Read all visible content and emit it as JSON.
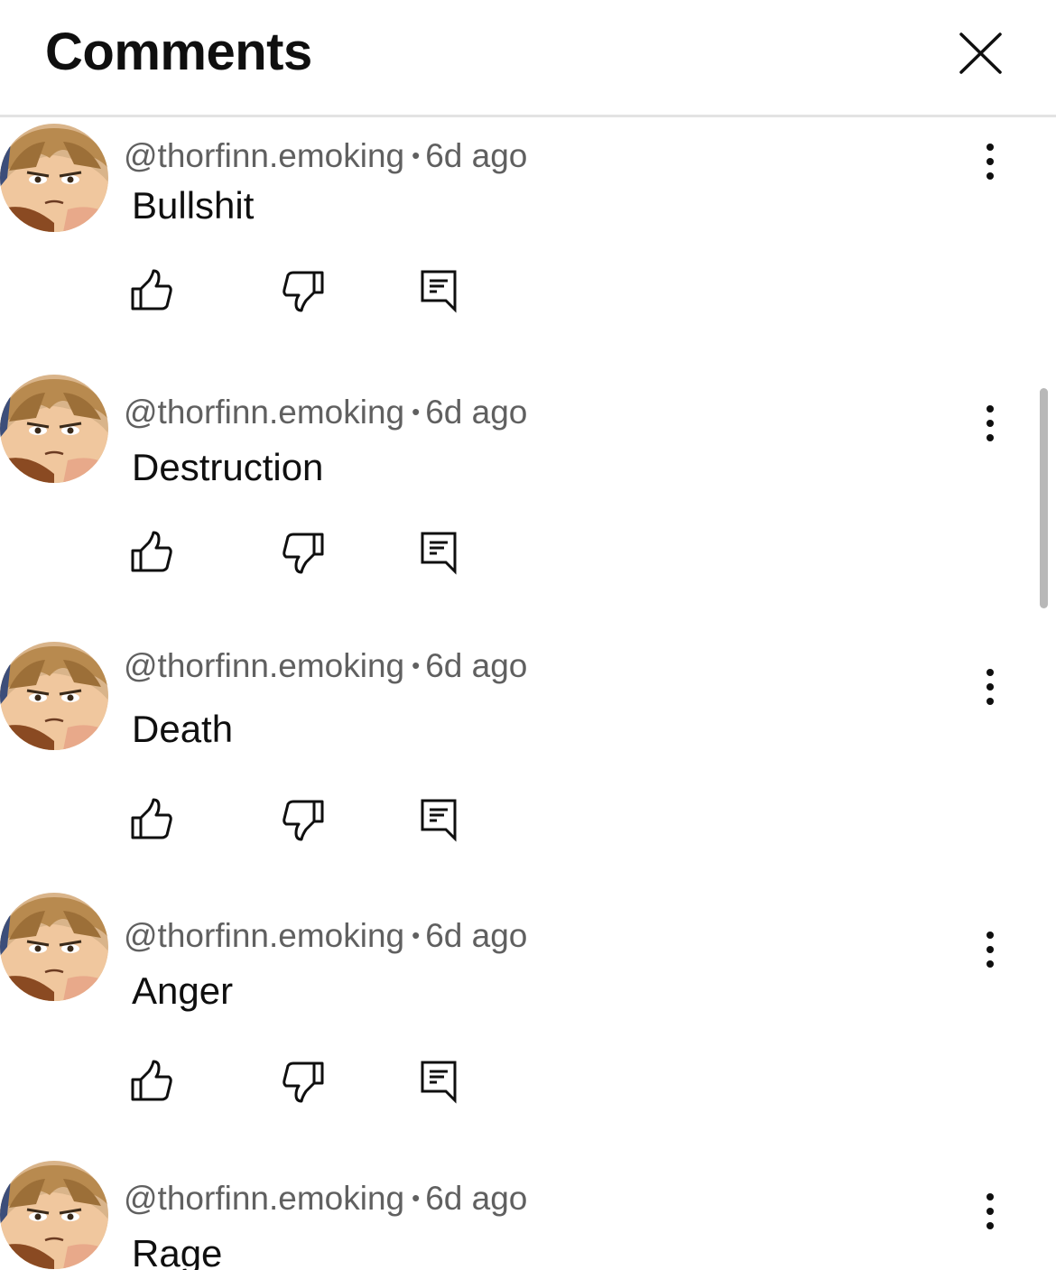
{
  "header": {
    "title": "Comments",
    "close_icon": "close-icon"
  },
  "comments": [
    {
      "handle": "@thorfinn.emoking",
      "separator": "•",
      "time": "6d ago",
      "text": "Bullshit"
    },
    {
      "handle": "@thorfinn.emoking",
      "separator": "•",
      "time": "6d ago",
      "text": "Destruction"
    },
    {
      "handle": "@thorfinn.emoking",
      "separator": "•",
      "time": "6d ago",
      "text": "Death"
    },
    {
      "handle": "@thorfinn.emoking",
      "separator": "•",
      "time": "6d ago",
      "text": "Anger"
    },
    {
      "handle": "@thorfinn.emoking",
      "separator": "•",
      "time": "6d ago",
      "text": "Rage"
    }
  ],
  "icons": {
    "like": "thumbs-up-icon",
    "dislike": "thumbs-down-icon",
    "reply": "reply-comment-icon",
    "more": "more-vertical-icon"
  },
  "colors": {
    "text_primary": "#0f0f0f",
    "text_secondary": "#606060",
    "divider": "#e3e3e3",
    "scrollbar": "#b8b8b8"
  }
}
